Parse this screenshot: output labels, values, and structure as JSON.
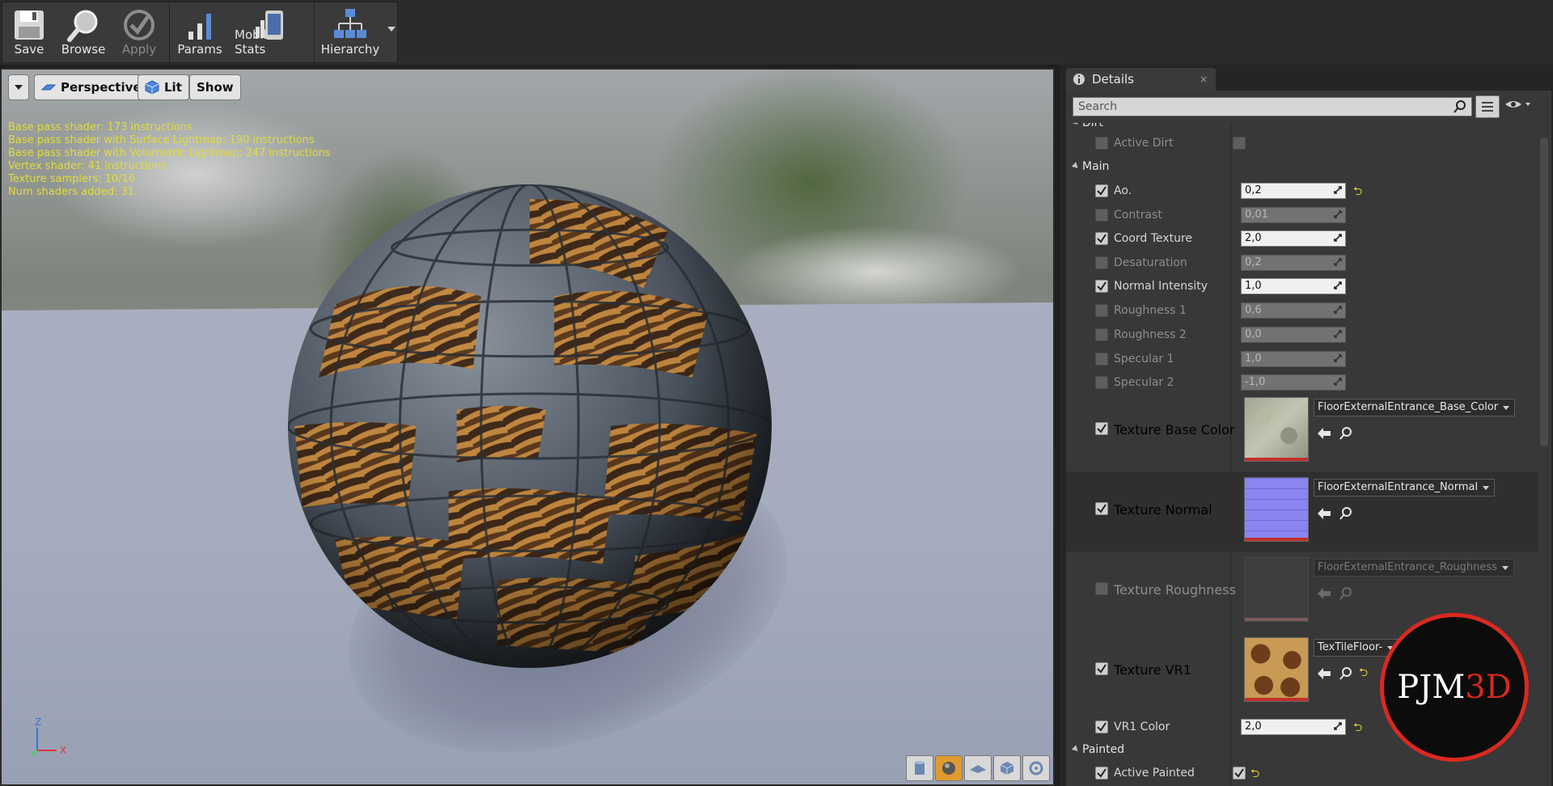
{
  "toolbar": {
    "buttons": [
      {
        "label": "Save",
        "icon": "save-icon"
      },
      {
        "label": "Browse",
        "icon": "browse-icon"
      },
      {
        "label": "Apply",
        "icon": "apply-icon",
        "disabled": true
      },
      {
        "label": "Params",
        "icon": "params-icon"
      },
      {
        "label": "Mobile Stats",
        "icon": "mobile-stats-icon"
      },
      {
        "label": "Hierarchy",
        "icon": "hierarchy-icon"
      }
    ]
  },
  "viewport": {
    "perspective_label": "Perspective",
    "lit_label": "Lit",
    "show_label": "Show",
    "stats": [
      "Base pass shader: 173 instructions",
      "Base pass shader with Surface Lightmap: 190 instructions",
      "Base pass shader with Volumetric Lightmap: 247 instructions",
      "Vertex shader: 41 instructions",
      "Texture samplers: 10/16",
      "Num shaders added: 31"
    ],
    "axis": {
      "z": "Z",
      "x": "X"
    },
    "preview_shapes": [
      "cylinder-icon",
      "sphere-icon",
      "plane-icon",
      "cube-icon",
      "custom-mesh-icon"
    ],
    "active_shape": "sphere-icon"
  },
  "details": {
    "tab_label": "Details",
    "tab_close": "×",
    "search_placeholder": "Search",
    "categories": {
      "dirt": "Dirt",
      "main": "Main",
      "painted": "Painted"
    },
    "dirt": {
      "label": "Active Dirt",
      "checked": false
    },
    "params": [
      {
        "label": "Ao.",
        "value": "0,2",
        "checked": true,
        "reset": true
      },
      {
        "label": "Contrast",
        "value": "0,01",
        "checked": false
      },
      {
        "label": "Coord Texture",
        "value": "2,0",
        "checked": true
      },
      {
        "label": "Desaturation",
        "value": "0,2",
        "checked": false
      },
      {
        "label": "Normal Intensity",
        "value": "1,0",
        "checked": true
      },
      {
        "label": "Roughness 1",
        "value": "0,6",
        "checked": false
      },
      {
        "label": "Roughness 2",
        "value": "0,0",
        "checked": false
      },
      {
        "label": "Specular 1",
        "value": "1,0",
        "checked": false
      },
      {
        "label": "Specular 2",
        "value": "-1,0",
        "checked": false
      }
    ],
    "textures": [
      {
        "label": "Texture Base Color",
        "asset": "FloorExternalEntrance_Base_Color",
        "checked": true
      },
      {
        "label": "Texture Normal",
        "asset": "FloorExternalEntrance_Normal",
        "checked": true
      },
      {
        "label": "Texture Roughness",
        "asset": "FloorExternalEntrance_Roughness",
        "checked": false
      },
      {
        "label": "Texture VR1",
        "asset": "TexTileFloor-",
        "checked": true,
        "reset": true
      }
    ],
    "vr1_color": {
      "label": "VR1 Color",
      "value": "2,0",
      "checked": true,
      "reset": true
    },
    "painted": {
      "label": "Active Painted",
      "checked": true,
      "reset": true
    }
  },
  "watermark": {
    "black": "PJM",
    "red": "3D"
  },
  "colors": {
    "accent_reset": "#e8d23a",
    "active_shape": "#e09b2e",
    "stats_text": "#e0dc3c",
    "watermark_ring": "#d9291f"
  }
}
